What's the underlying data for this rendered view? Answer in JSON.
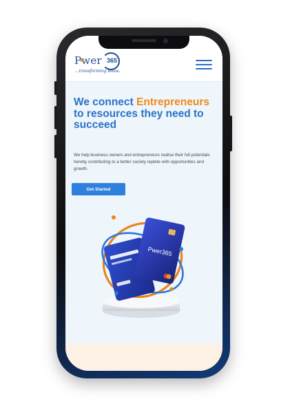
{
  "header": {
    "logo_word": "Pwer",
    "logo_number": "365",
    "tagline": "...transforming ideas."
  },
  "hero": {
    "title_part1": "We connect",
    "title_accent": "Entrepreneurs",
    "title_part2": " to resources they need to succeed",
    "description": "We help business owners and entrepreneurs realise their full potentials hereby contributing to a better society replete with opportunities and growth.",
    "cta_label": "Get Started"
  },
  "illustration": {
    "card_brand": "Pwer365"
  },
  "colors": {
    "brand_blue": "#2a73c8",
    "accent_orange": "#ef8a1f",
    "button_blue": "#2f80dc",
    "navy": "#1d4f91"
  },
  "icons": [
    "menu-icon"
  ]
}
